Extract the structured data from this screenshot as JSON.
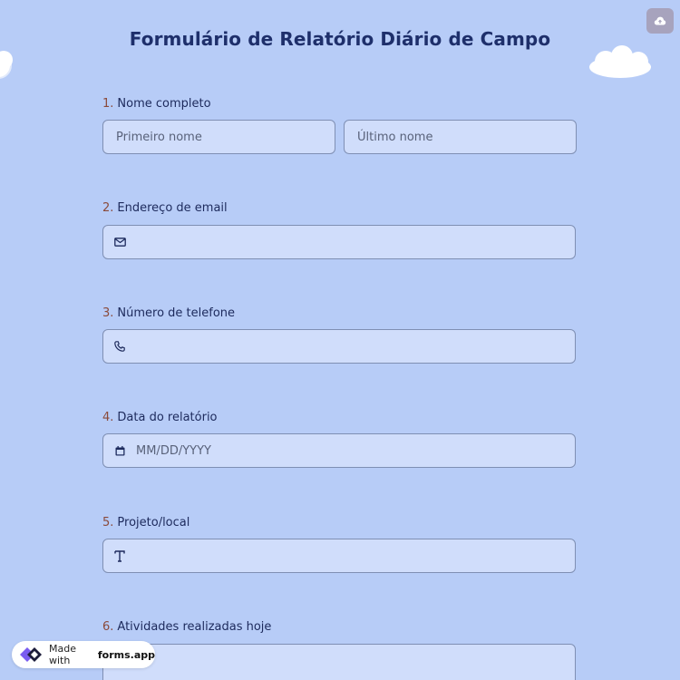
{
  "form": {
    "title": "Formulário de Relatório Diário de Campo"
  },
  "questions": [
    {
      "number": "1.",
      "label": "Nome completo",
      "fields": [
        {
          "placeholder": "Primeiro nome"
        },
        {
          "placeholder": "Último nome"
        }
      ]
    },
    {
      "number": "2.",
      "label": "Endereço de email",
      "icon": "envelope-icon",
      "value": ""
    },
    {
      "number": "3.",
      "label": "Número de telefone",
      "icon": "phone-icon",
      "value": ""
    },
    {
      "number": "4.",
      "label": "Data do relatório",
      "icon": "calendar-icon",
      "placeholder": "MM/DD/YYYY"
    },
    {
      "number": "5.",
      "label": "Projeto/local",
      "icon": "text-icon",
      "value": ""
    },
    {
      "number": "6.",
      "label": "Atividades realizadas hoje",
      "value": ""
    }
  ],
  "badge": {
    "made_with": "Made with",
    "brand": "forms.app"
  },
  "toolbar": {
    "upload_icon": "cloud-upload-icon"
  },
  "colors": {
    "background": "#b7ccf7",
    "field_bg": "#d0ddfb",
    "field_border": "#7f8fb3",
    "title": "#1e2f6b",
    "number": "#8a4a3a"
  }
}
